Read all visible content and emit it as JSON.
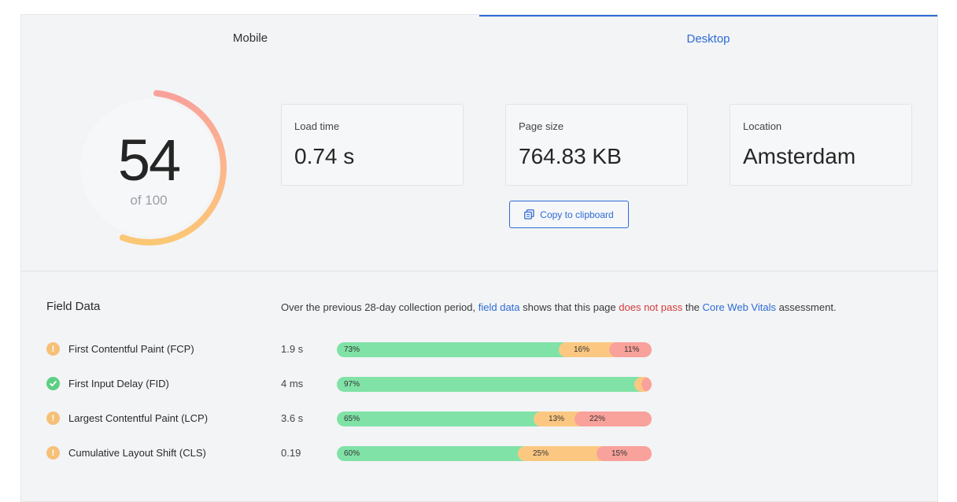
{
  "tabs": [
    {
      "label": "Mobile",
      "active": false
    },
    {
      "label": "Desktop",
      "active": true
    }
  ],
  "score": {
    "value": "54",
    "of": "of 100",
    "fraction": 0.54
  },
  "cards": [
    {
      "label": "Load time",
      "value": "0.74 s"
    },
    {
      "label": "Page size",
      "value": "764.83 KB"
    },
    {
      "label": "Location",
      "value": "Amsterdam"
    }
  ],
  "copy_button": {
    "label": "Copy to clipboard",
    "icon": "copy-icon"
  },
  "field_data": {
    "title": "Field Data",
    "desc": {
      "t1": "Over the previous 28-day collection period, ",
      "link1": "field data",
      "t2": " shows that this page ",
      "fail": "does not pass",
      "t3": " the ",
      "link2": "Core Web Vitals",
      "t4": " assessment."
    },
    "metrics": [
      {
        "name": "First Contentful Paint (FCP)",
        "value": "1.9 s",
        "status": "warn",
        "good": 73,
        "avg": 16,
        "poor": 11,
        "good_label": "73%",
        "avg_label": "16%",
        "poor_label": "11%"
      },
      {
        "name": "First Input Delay (FID)",
        "value": "4 ms",
        "status": "ok",
        "good": 97,
        "avg": 2,
        "poor": 1,
        "good_label": "97%",
        "avg_label": "2%",
        "poor_label": "1%"
      },
      {
        "name": "Largest Contentful Paint (LCP)",
        "value": "3.6 s",
        "status": "warn",
        "good": 65,
        "avg": 13,
        "poor": 22,
        "good_label": "65%",
        "avg_label": "13%",
        "poor_label": "22%"
      },
      {
        "name": "Cumulative Layout Shift (CLS)",
        "value": "0.19",
        "status": "warn",
        "good": 60,
        "avg": 25,
        "poor": 15,
        "good_label": "60%",
        "avg_label": "25%",
        "poor_label": "15%"
      }
    ]
  },
  "colors": {
    "accent": "#2d6bd6",
    "good": "#80e2a6",
    "average": "#fcc881",
    "poor": "#f9a19b",
    "fail_text": "#d33a3a"
  }
}
